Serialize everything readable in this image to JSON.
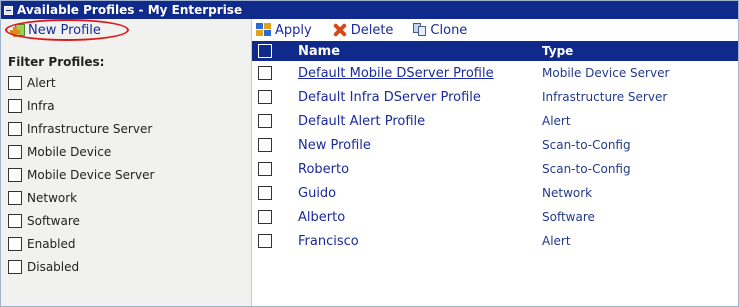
{
  "window": {
    "title": "Available Profiles - My Enterprise"
  },
  "left": {
    "new_profile_label": "New Profile",
    "filter_heading": "Filter Profiles:",
    "filters": [
      {
        "label": "Alert"
      },
      {
        "label": "Infra"
      },
      {
        "label": "Infrastructure Server"
      },
      {
        "label": "Mobile Device"
      },
      {
        "label": "Mobile Device Server"
      },
      {
        "label": "Network"
      },
      {
        "label": "Software"
      },
      {
        "label": "Enabled"
      },
      {
        "label": "Disabled"
      }
    ]
  },
  "toolbar": {
    "apply_label": "Apply",
    "delete_label": "Delete",
    "clone_label": "Clone"
  },
  "table": {
    "columns": {
      "name": "Name",
      "type": "Type"
    },
    "rows": [
      {
        "name": "Default Mobile DServer Profile",
        "type": "Mobile Device Server"
      },
      {
        "name": "Default Infra DServer Profile",
        "type": "Infrastructure Server"
      },
      {
        "name": "Default Alert Profile",
        "type": "Alert"
      },
      {
        "name": "New Profile",
        "type": "Scan-to-Config"
      },
      {
        "name": "Roberto",
        "type": "Scan-to-Config"
      },
      {
        "name": "Guido",
        "type": "Network"
      },
      {
        "name": "Alberto",
        "type": "Software"
      },
      {
        "name": "Francisco",
        "type": "Alert"
      }
    ]
  },
  "colors": {
    "title_bar": "#0f2a8a",
    "highlight_ring": "#e01818",
    "link": "#1a2a9a"
  }
}
